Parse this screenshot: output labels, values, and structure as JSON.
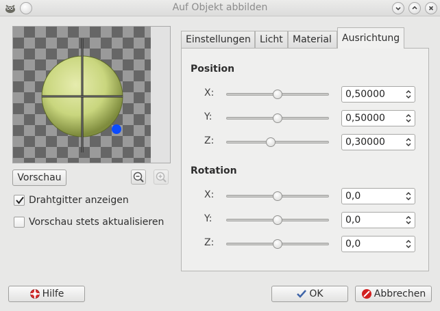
{
  "window": {
    "title": "Auf Objekt abbilden"
  },
  "preview": {
    "button_label": "Vorschau",
    "zoom_out_icon": "zoom-out-icon",
    "zoom_in_icon": "zoom-in-icon"
  },
  "options": {
    "wireframe": {
      "label": "Drahtgitter anzeigen",
      "checked": true
    },
    "auto_update": {
      "label": "Vorschau stets aktualisieren",
      "checked": false
    }
  },
  "tabs": [
    {
      "label": "Einstellungen",
      "active": false
    },
    {
      "label": "Licht",
      "active": false
    },
    {
      "label": "Material",
      "active": false
    },
    {
      "label": "Ausrichtung",
      "active": true
    }
  ],
  "position": {
    "title": "Position",
    "rows": [
      {
        "axis": "X:",
        "value": "0,50000",
        "level": 0.5
      },
      {
        "axis": "Y:",
        "value": "0,50000",
        "level": 0.5
      },
      {
        "axis": "Z:",
        "value": "0,30000",
        "level": 0.43
      }
    ]
  },
  "rotation": {
    "title": "Rotation",
    "rows": [
      {
        "axis": "X:",
        "value": "0,0",
        "level": 0.5
      },
      {
        "axis": "Y:",
        "value": "0,0",
        "level": 0.5
      },
      {
        "axis": "Z:",
        "value": "0,0",
        "level": 0.5
      }
    ]
  },
  "footer": {
    "help_label": "Hilfe",
    "ok_label": "OK",
    "cancel_label": "Abbrechen"
  },
  "colors": {
    "sphere": "#c9d67e",
    "light_marker": "#0b4bff",
    "cancel_icon": "#d22020",
    "ok_icon": "#3e64a8"
  }
}
